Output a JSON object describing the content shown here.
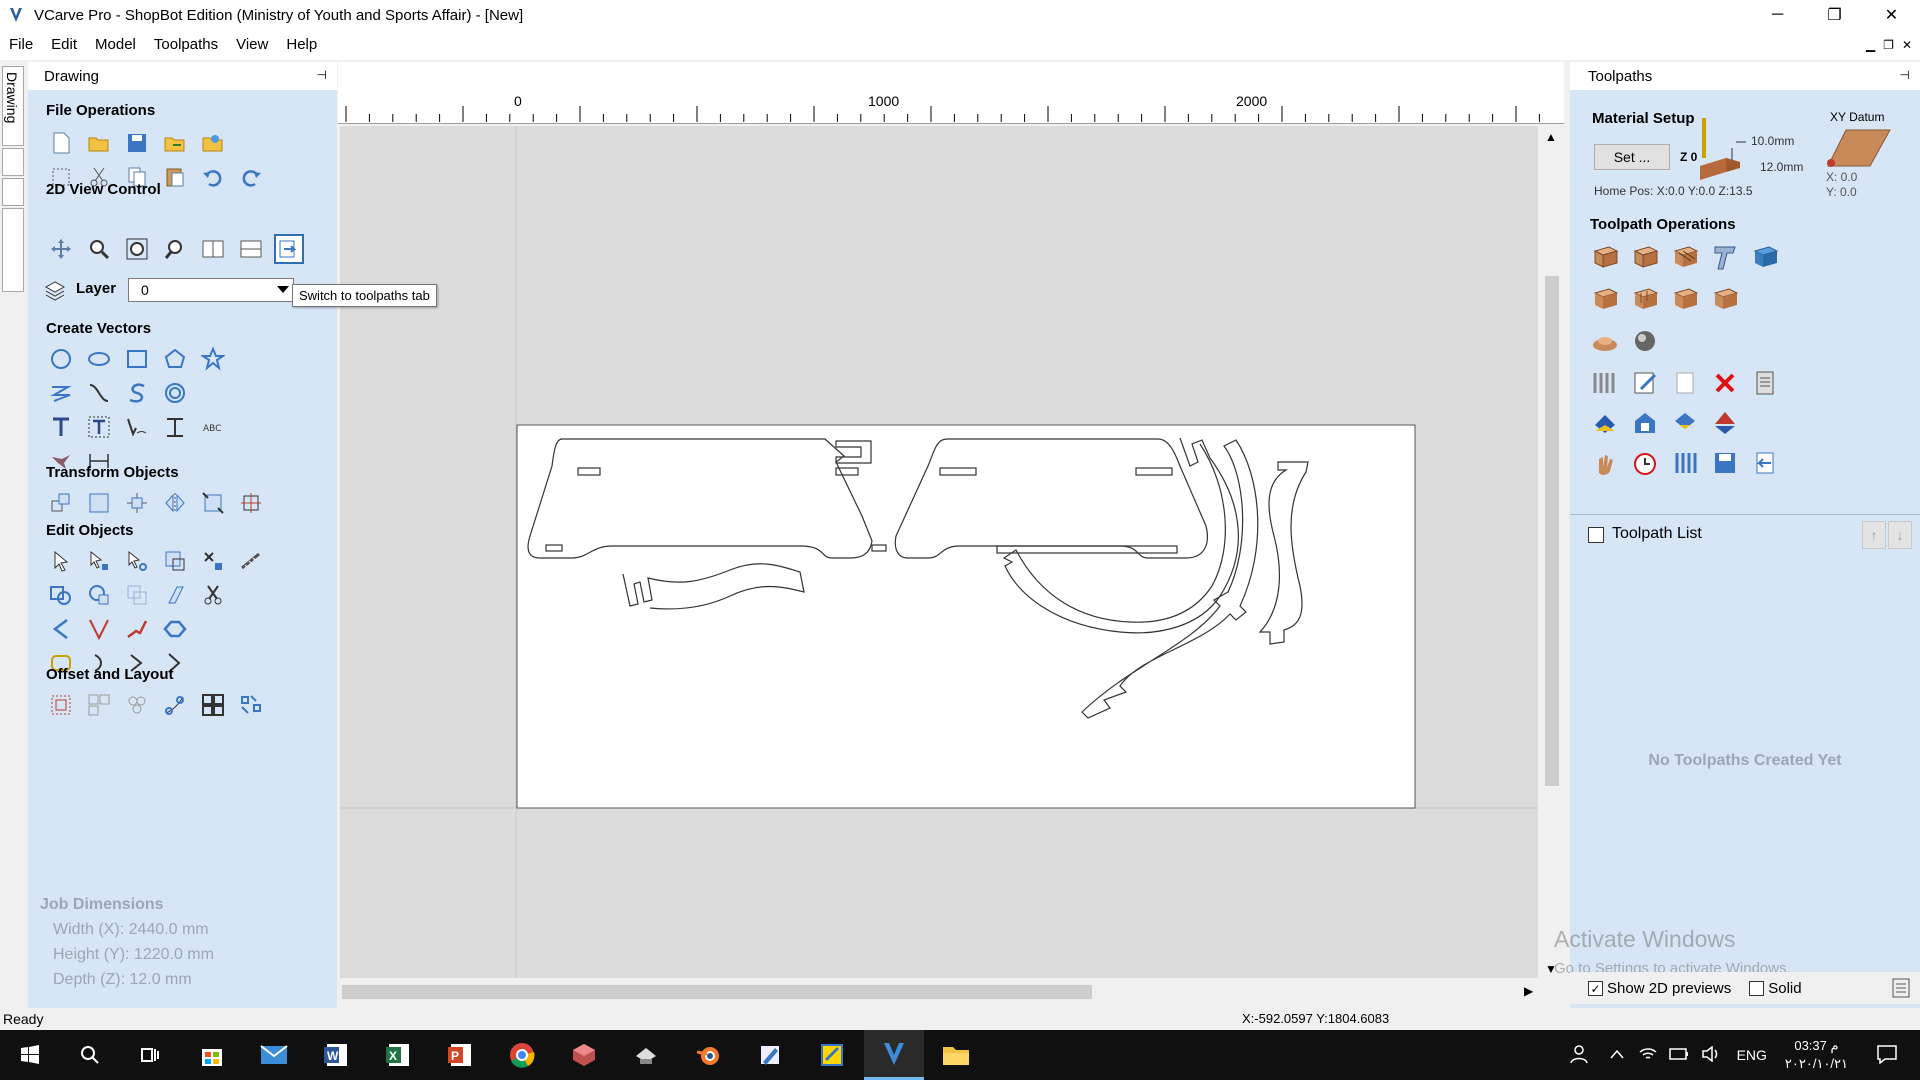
{
  "window": {
    "title": "VCarve Pro - ShopBot Edition (Ministry of Youth and Sports Affair) - [New]",
    "minimize": "─",
    "maximize": "❐",
    "close": "✕"
  },
  "menu": [
    "File",
    "Edit",
    "Model",
    "Toolpaths",
    "View",
    "Help"
  ],
  "mdi": {
    "min": "▁",
    "restore": "❐",
    "close": "✕"
  },
  "side_tab": {
    "label": "Drawing"
  },
  "left_panel": {
    "title": "Drawing",
    "pin": "⊣",
    "sections": {
      "file_ops": "File Operations",
      "view_control": "2D View Control",
      "create_vectors": "Create Vectors",
      "transform": "Transform Objects",
      "edit_objects": "Edit Objects",
      "offset_layout": "Offset and Layout"
    },
    "layer": {
      "label": "Layer",
      "value": "0"
    },
    "tooltip": "Switch to toolpaths tab",
    "job_dimensions": {
      "title": "Job Dimensions",
      "width": "Width  (X): 2440.0 mm",
      "height": "Height (Y): 1220.0 mm",
      "depth": "Depth  (Z): 12.0 mm"
    }
  },
  "ruler": {
    "labels": [
      "0",
      "1000",
      "2000"
    ]
  },
  "right_panel": {
    "title": "Toolpaths",
    "pin": "⊣",
    "material": {
      "title": "Material Setup",
      "set_button": "Set ...",
      "z0": "Z 0",
      "thickness_top": "10.0mm",
      "thickness": "12.0mm",
      "home_pos": "Home Pos:  X:0.0 Y:0.0 Z:13.5"
    },
    "xy_datum": {
      "title": "XY Datum",
      "x": "X: 0.0",
      "y": "Y: 0.0"
    },
    "toolpath_ops_title": "Toolpath Operations",
    "toolpath_list_title": "Toolpath List",
    "no_toolpaths": "No Toolpaths Created Yet",
    "show_previews": "Show 2D previews",
    "solid": "Solid",
    "up_arrow": "↑",
    "down_arrow": "↓"
  },
  "watermark": {
    "line1": "Activate Windows",
    "line2": "Go to Settings to activate Windows."
  },
  "status": {
    "left": "Ready",
    "coords": "X:-592.0597 Y:1804.6083"
  },
  "taskbar": {
    "lang": "ENG",
    "time": "03:37 م",
    "date": "٢٠٢٠/١٠/٢١"
  }
}
